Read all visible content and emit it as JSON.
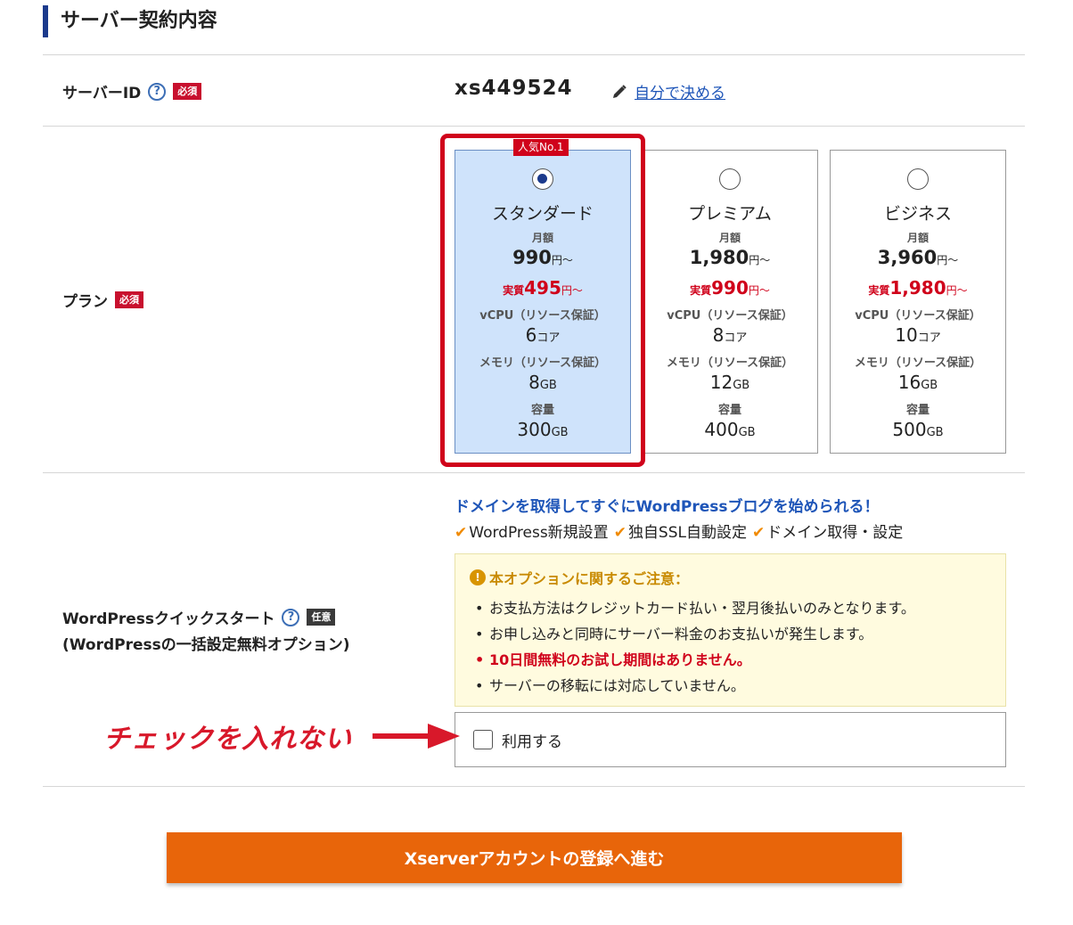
{
  "section": {
    "title": "サーバー契約内容"
  },
  "server_id_row": {
    "label": "サーバーID",
    "help": "?",
    "badge": "必須",
    "value": "xs449524",
    "edit_link": "自分で決める"
  },
  "plan_row": {
    "label": "プラン",
    "badge": "必須",
    "popular_tag": "人気No.1",
    "plans": [
      {
        "name": "スタンダード",
        "monthly_label": "月額",
        "price": "990",
        "price_unit": "円〜",
        "real_prefix": "実質",
        "real_price": "495",
        "real_unit": "円〜",
        "cpu_label": "vCPU（リソース保証）",
        "cpu_value": "6",
        "cpu_unit": "コア",
        "mem_label": "メモリ（リソース保証）",
        "mem_value": "8",
        "mem_unit": "GB",
        "disk_label": "容量",
        "disk_value": "300",
        "disk_unit": "GB",
        "selected": true
      },
      {
        "name": "プレミアム",
        "monthly_label": "月額",
        "price": "1,980",
        "price_unit": "円〜",
        "real_prefix": "実質",
        "real_price": "990",
        "real_unit": "円〜",
        "cpu_label": "vCPU（リソース保証）",
        "cpu_value": "8",
        "cpu_unit": "コア",
        "mem_label": "メモリ（リソース保証）",
        "mem_value": "12",
        "mem_unit": "GB",
        "disk_label": "容量",
        "disk_value": "400",
        "disk_unit": "GB",
        "selected": false
      },
      {
        "name": "ビジネス",
        "monthly_label": "月額",
        "price": "3,960",
        "price_unit": "円〜",
        "real_prefix": "実質",
        "real_price": "1,980",
        "real_unit": "円〜",
        "cpu_label": "vCPU（リソース保証）",
        "cpu_value": "10",
        "cpu_unit": "コア",
        "mem_label": "メモリ（リソース保証）",
        "mem_value": "16",
        "mem_unit": "GB",
        "disk_label": "容量",
        "disk_value": "500",
        "disk_unit": "GB",
        "selected": false
      }
    ]
  },
  "wp_row": {
    "label_line1": "WordPressクイックスタート",
    "label_line2": "(WordPressの一括設定無料オプション)",
    "help": "?",
    "badge": "任意",
    "headline": "ドメインを取得してすぐにWordPressブログを始められる！",
    "features": [
      "WordPress新規設置",
      "独自SSL自動設定",
      "ドメイン取得・設定"
    ],
    "notice_icon": "!",
    "notice_title": "本オプションに関するご注意：",
    "notice_items": [
      "お支払方法はクレジットカード払い・翌月後払いのみとなります。",
      "お申し込みと同時にサーバー料金のお支払いが発生します。",
      "10日間無料のお試し期間はありません。",
      "サーバーの移転には対応していません。"
    ],
    "use_label": "利用する",
    "use_checked": false
  },
  "annotation": {
    "text": "チェックを入れない",
    "color": "#d8182a"
  },
  "submit": {
    "label": "Xserverアカウントの登録へ進む",
    "color": "#e8650a"
  },
  "colors": {
    "accent": "#1b3a8c",
    "link": "#1e55b8",
    "alert": "#d0021b",
    "selected_bg": "#cfe3fb"
  }
}
